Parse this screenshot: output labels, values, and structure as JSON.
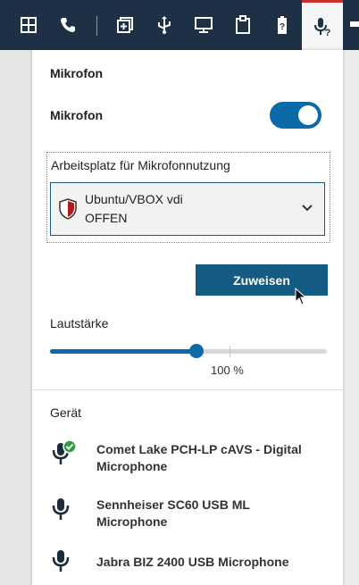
{
  "toolbar": {
    "icons": [
      "grid-icon",
      "phone-icon",
      "window-add-icon",
      "usb-icon",
      "monitor-icon",
      "clipboard-icon",
      "battery-icon",
      "microphone-help-icon"
    ]
  },
  "panel": {
    "title": "Mikrofon",
    "toggle_label": "Mikrofon",
    "toggle_on": true,
    "workspace_label": "Arbeitsplatz für Mikrofonnutzung",
    "workspace_selected": "Ubuntu/VBOX vdi",
    "workspace_status": "OFFEN",
    "assign_button": "Zuweisen",
    "volume_label": "Lautstärke",
    "volume_percent": 53,
    "volume_value": "100 %",
    "device_title": "Gerät",
    "devices": [
      {
        "name": "Comet Lake PCH-LP cAVS - Digital Microphone",
        "selected": true
      },
      {
        "name": "Sennheiser SC60 USB ML Microphone",
        "selected": false
      },
      {
        "name": "Jabra BIZ 2400 USB Microphone",
        "selected": false
      }
    ]
  },
  "colors": {
    "toolbar_bg": "#1d3045",
    "accent": "#0b6aa8",
    "button_bg": "#135b82",
    "active_tab_border": "#c9302c",
    "check_green": "#2e9d3f"
  }
}
